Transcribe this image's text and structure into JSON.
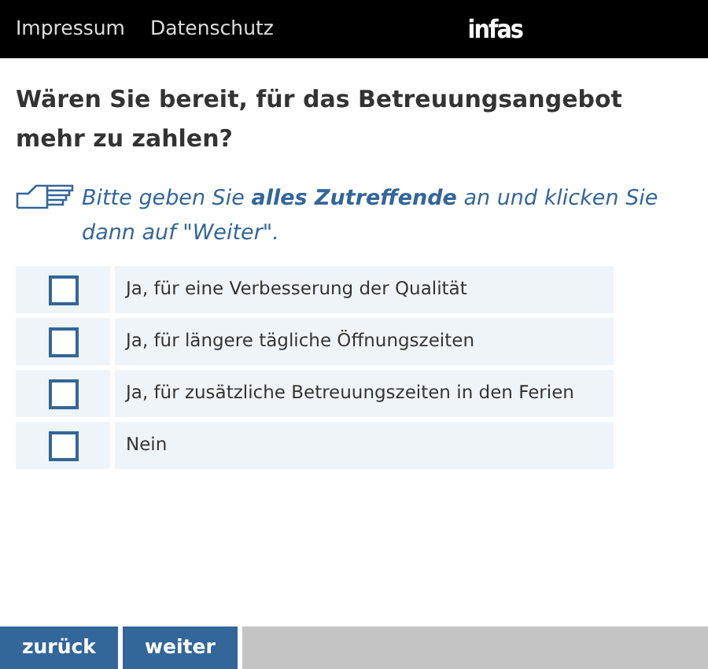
{
  "header": {
    "links": [
      "Impressum",
      "Datenschutz"
    ],
    "logo": "infas"
  },
  "question": "Wären Sie bereit, für das Betreuungsangebot mehr zu zahlen?",
  "instruction": "Bitte geben Sie **alles Zutreffende** an und klicken Sie dann auf \"Weiter\".",
  "options": [
    {
      "label": "Ja, für eine Verbesserung der Qualität",
      "checked": false
    },
    {
      "label": "Ja, für längere tägliche Öffnungszeiten",
      "checked": false
    },
    {
      "label": "Ja, für zusätzliche Betreuungszeiten in den Ferien",
      "checked": false
    },
    {
      "label": "Nein",
      "checked": false
    }
  ],
  "buttons": [
    "zurück",
    "weiter"
  ]
}
